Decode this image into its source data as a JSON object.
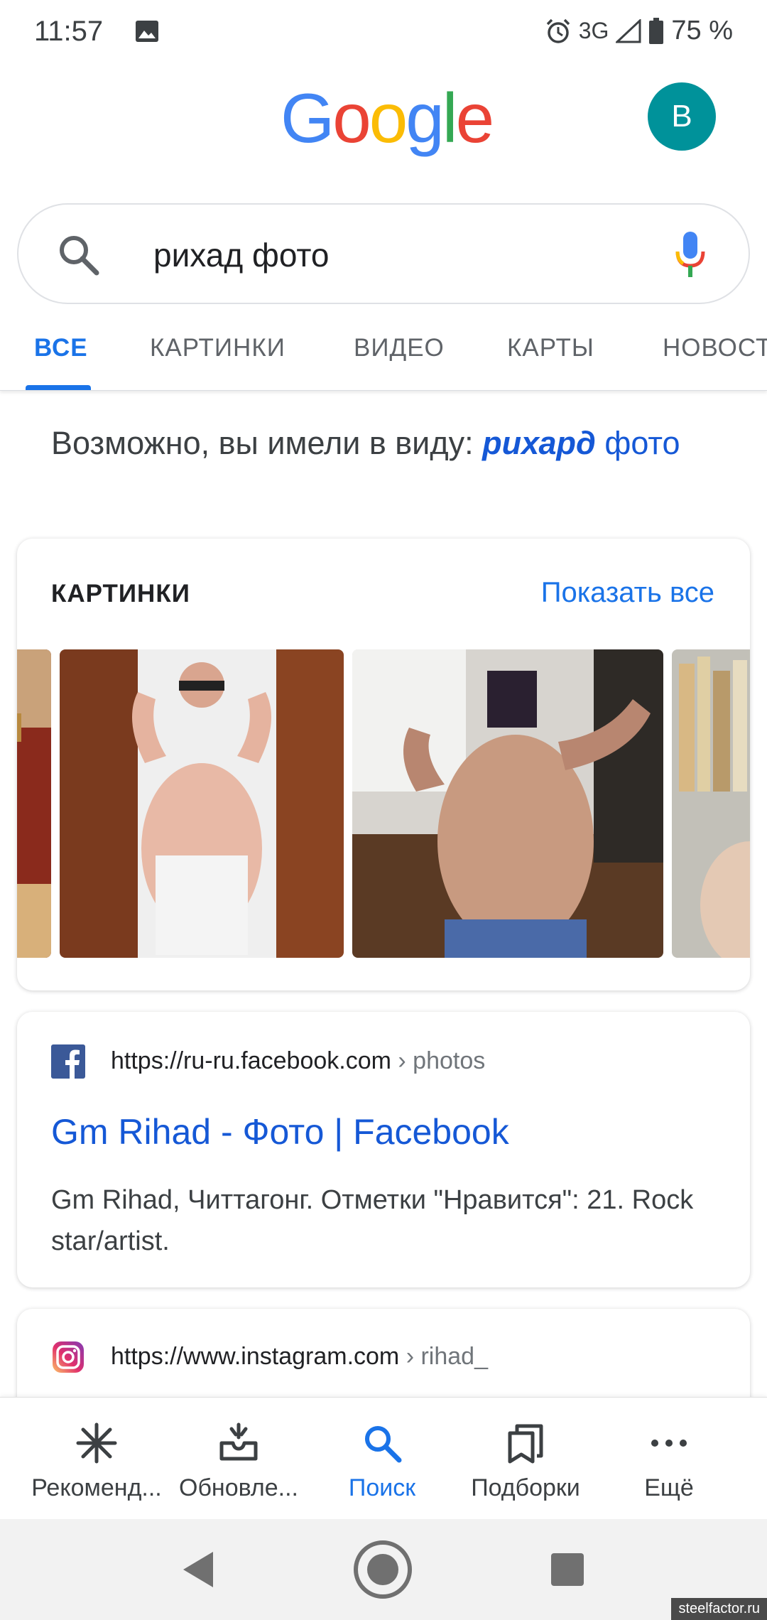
{
  "status_bar": {
    "time": "11:57",
    "network": "3G",
    "battery": "75 %"
  },
  "header": {
    "avatar_letter": "B"
  },
  "search": {
    "query": "рихад фото"
  },
  "tabs": [
    {
      "label": "ВСЕ"
    },
    {
      "label": "КАРТИНКИ"
    },
    {
      "label": "ВИДЕО"
    },
    {
      "label": "КАРТЫ"
    },
    {
      "label": "НОВОСТИ"
    }
  ],
  "did_you_mean": {
    "prefix": "Возможно, вы имели в виду:",
    "suggestion_bold": "рихард",
    "suggestion_rest": "фото"
  },
  "images_section": {
    "title": "КАРТИНКИ",
    "show_all": "Показать все"
  },
  "results": [
    {
      "url": "https://ru-ru.facebook.com",
      "crumb": "› photos",
      "title": "Gm Rihad - Фото | Facebook",
      "snippet": "Gm Rihad, Читтагонг. Отметки \"Нравится\": 21. Rock star/artist.",
      "favicon": "facebook-icon"
    },
    {
      "url": "https://www.instagram.com",
      "crumb": "› rihad_",
      "favicon": "instagram-icon"
    }
  ],
  "bottom_nav": [
    {
      "label": "Рекоменд...",
      "icon": "asterisk-icon"
    },
    {
      "label": "Обновле...",
      "icon": "updates-icon"
    },
    {
      "label": "Поиск",
      "icon": "search-icon"
    },
    {
      "label": "Подборки",
      "icon": "collections-icon"
    },
    {
      "label": "Ещё",
      "icon": "more-icon"
    }
  ],
  "watermark": "steelfactor.ru",
  "colors": {
    "accent": "#1a73e8",
    "avatar": "#00929a"
  }
}
